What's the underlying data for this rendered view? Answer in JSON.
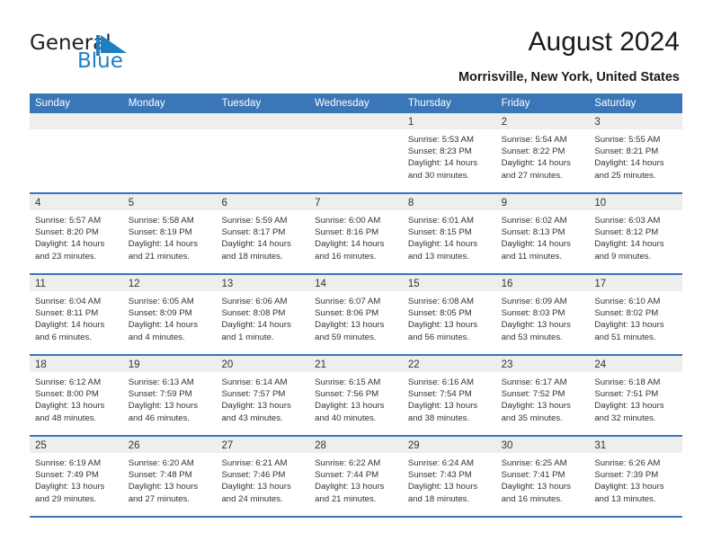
{
  "brand": {
    "name_part1": "General",
    "name_part2": "Blue",
    "mark_color": "#1f7fc4"
  },
  "header": {
    "title": "August 2024",
    "subtitle": "Morrisville, New York, United States"
  },
  "theme": {
    "header_blue": "#3a76b8",
    "daynum_band": "#eeeeee",
    "text": "#333333"
  },
  "calendar": {
    "weekday_headers": [
      "Sunday",
      "Monday",
      "Tuesday",
      "Wednesday",
      "Thursday",
      "Friday",
      "Saturday"
    ],
    "weeks": [
      [
        {
          "day": "",
          "lines": []
        },
        {
          "day": "",
          "lines": []
        },
        {
          "day": "",
          "lines": []
        },
        {
          "day": "",
          "lines": []
        },
        {
          "day": "1",
          "lines": [
            "Sunrise: 5:53 AM",
            "Sunset: 8:23 PM",
            "Daylight: 14 hours",
            "and 30 minutes."
          ]
        },
        {
          "day": "2",
          "lines": [
            "Sunrise: 5:54 AM",
            "Sunset: 8:22 PM",
            "Daylight: 14 hours",
            "and 27 minutes."
          ]
        },
        {
          "day": "3",
          "lines": [
            "Sunrise: 5:55 AM",
            "Sunset: 8:21 PM",
            "Daylight: 14 hours",
            "and 25 minutes."
          ]
        }
      ],
      [
        {
          "day": "4",
          "lines": [
            "Sunrise: 5:57 AM",
            "Sunset: 8:20 PM",
            "Daylight: 14 hours",
            "and 23 minutes."
          ]
        },
        {
          "day": "5",
          "lines": [
            "Sunrise: 5:58 AM",
            "Sunset: 8:19 PM",
            "Daylight: 14 hours",
            "and 21 minutes."
          ]
        },
        {
          "day": "6",
          "lines": [
            "Sunrise: 5:59 AM",
            "Sunset: 8:17 PM",
            "Daylight: 14 hours",
            "and 18 minutes."
          ]
        },
        {
          "day": "7",
          "lines": [
            "Sunrise: 6:00 AM",
            "Sunset: 8:16 PM",
            "Daylight: 14 hours",
            "and 16 minutes."
          ]
        },
        {
          "day": "8",
          "lines": [
            "Sunrise: 6:01 AM",
            "Sunset: 8:15 PM",
            "Daylight: 14 hours",
            "and 13 minutes."
          ]
        },
        {
          "day": "9",
          "lines": [
            "Sunrise: 6:02 AM",
            "Sunset: 8:13 PM",
            "Daylight: 14 hours",
            "and 11 minutes."
          ]
        },
        {
          "day": "10",
          "lines": [
            "Sunrise: 6:03 AM",
            "Sunset: 8:12 PM",
            "Daylight: 14 hours",
            "and 9 minutes."
          ]
        }
      ],
      [
        {
          "day": "11",
          "lines": [
            "Sunrise: 6:04 AM",
            "Sunset: 8:11 PM",
            "Daylight: 14 hours",
            "and 6 minutes."
          ]
        },
        {
          "day": "12",
          "lines": [
            "Sunrise: 6:05 AM",
            "Sunset: 8:09 PM",
            "Daylight: 14 hours",
            "and 4 minutes."
          ]
        },
        {
          "day": "13",
          "lines": [
            "Sunrise: 6:06 AM",
            "Sunset: 8:08 PM",
            "Daylight: 14 hours",
            "and 1 minute."
          ]
        },
        {
          "day": "14",
          "lines": [
            "Sunrise: 6:07 AM",
            "Sunset: 8:06 PM",
            "Daylight: 13 hours",
            "and 59 minutes."
          ]
        },
        {
          "day": "15",
          "lines": [
            "Sunrise: 6:08 AM",
            "Sunset: 8:05 PM",
            "Daylight: 13 hours",
            "and 56 minutes."
          ]
        },
        {
          "day": "16",
          "lines": [
            "Sunrise: 6:09 AM",
            "Sunset: 8:03 PM",
            "Daylight: 13 hours",
            "and 53 minutes."
          ]
        },
        {
          "day": "17",
          "lines": [
            "Sunrise: 6:10 AM",
            "Sunset: 8:02 PM",
            "Daylight: 13 hours",
            "and 51 minutes."
          ]
        }
      ],
      [
        {
          "day": "18",
          "lines": [
            "Sunrise: 6:12 AM",
            "Sunset: 8:00 PM",
            "Daylight: 13 hours",
            "and 48 minutes."
          ]
        },
        {
          "day": "19",
          "lines": [
            "Sunrise: 6:13 AM",
            "Sunset: 7:59 PM",
            "Daylight: 13 hours",
            "and 46 minutes."
          ]
        },
        {
          "day": "20",
          "lines": [
            "Sunrise: 6:14 AM",
            "Sunset: 7:57 PM",
            "Daylight: 13 hours",
            "and 43 minutes."
          ]
        },
        {
          "day": "21",
          "lines": [
            "Sunrise: 6:15 AM",
            "Sunset: 7:56 PM",
            "Daylight: 13 hours",
            "and 40 minutes."
          ]
        },
        {
          "day": "22",
          "lines": [
            "Sunrise: 6:16 AM",
            "Sunset: 7:54 PM",
            "Daylight: 13 hours",
            "and 38 minutes."
          ]
        },
        {
          "day": "23",
          "lines": [
            "Sunrise: 6:17 AM",
            "Sunset: 7:52 PM",
            "Daylight: 13 hours",
            "and 35 minutes."
          ]
        },
        {
          "day": "24",
          "lines": [
            "Sunrise: 6:18 AM",
            "Sunset: 7:51 PM",
            "Daylight: 13 hours",
            "and 32 minutes."
          ]
        }
      ],
      [
        {
          "day": "25",
          "lines": [
            "Sunrise: 6:19 AM",
            "Sunset: 7:49 PM",
            "Daylight: 13 hours",
            "and 29 minutes."
          ]
        },
        {
          "day": "26",
          "lines": [
            "Sunrise: 6:20 AM",
            "Sunset: 7:48 PM",
            "Daylight: 13 hours",
            "and 27 minutes."
          ]
        },
        {
          "day": "27",
          "lines": [
            "Sunrise: 6:21 AM",
            "Sunset: 7:46 PM",
            "Daylight: 13 hours",
            "and 24 minutes."
          ]
        },
        {
          "day": "28",
          "lines": [
            "Sunrise: 6:22 AM",
            "Sunset: 7:44 PM",
            "Daylight: 13 hours",
            "and 21 minutes."
          ]
        },
        {
          "day": "29",
          "lines": [
            "Sunrise: 6:24 AM",
            "Sunset: 7:43 PM",
            "Daylight: 13 hours",
            "and 18 minutes."
          ]
        },
        {
          "day": "30",
          "lines": [
            "Sunrise: 6:25 AM",
            "Sunset: 7:41 PM",
            "Daylight: 13 hours",
            "and 16 minutes."
          ]
        },
        {
          "day": "31",
          "lines": [
            "Sunrise: 6:26 AM",
            "Sunset: 7:39 PM",
            "Daylight: 13 hours",
            "and 13 minutes."
          ]
        }
      ]
    ]
  }
}
